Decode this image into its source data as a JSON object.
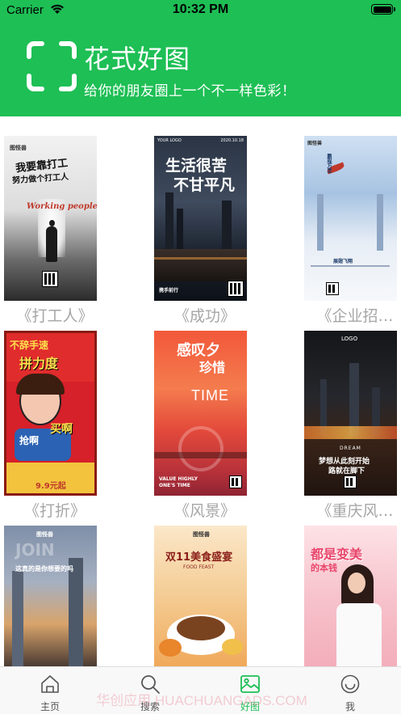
{
  "status_bar": {
    "carrier": "Carrier",
    "time": "10:32 PM"
  },
  "header": {
    "title": "花式好图",
    "subtitle": "给你的朋友圈上一个不一样色彩！"
  },
  "posters": [
    {
      "label": "《打工人》",
      "brand": "图怪兽",
      "text1": "我要靠打工",
      "text2": "努力做个打工人",
      "text3": "Working people"
    },
    {
      "label": "《成功》",
      "brand": "YOUR LOGO",
      "date": "2020.10.18",
      "text1": "生活很苦",
      "text2": "不甘平凡",
      "text3": "携手前行"
    },
    {
      "label": "《企业招…",
      "brand": "图怪兽",
      "text1": "鹏程万里",
      "text2": "展翅飞翔"
    },
    {
      "label": "《打折》",
      "text1": "不辞手速",
      "text2": "拼力度",
      "text3": "买啊",
      "text4": "抢啊",
      "text5": "9.9元起"
    },
    {
      "label": "《风景》",
      "text1": "感叹夕",
      "text2": "珍惜",
      "text3": "TIME",
      "text4": "VALUE HIGHLY",
      "text5": "ONE'S TIME"
    },
    {
      "label": "《重庆风…",
      "brand": "LOGO",
      "text1": "DREAM",
      "text2": "梦想从此刻开始",
      "text3": "路就在脚下"
    },
    {
      "label": "",
      "brand": "图怪兽",
      "text1": "JOIN",
      "text2": "这真的是你想要的吗"
    },
    {
      "label": "",
      "brand": "图怪兽",
      "text1": "双11美食盛宴",
      "text2": "FOOD FEAST"
    },
    {
      "label": "",
      "text1": "都是变美",
      "text2": "的本钱"
    }
  ],
  "tabs": [
    {
      "label": "主页"
    },
    {
      "label": "搜索"
    },
    {
      "label": "好图"
    },
    {
      "label": "我"
    }
  ],
  "watermark": "华创应用 HUACHUANGADS.COM",
  "colors": {
    "accent": "#1ebf55",
    "label_gray": "#a6a6a6"
  }
}
